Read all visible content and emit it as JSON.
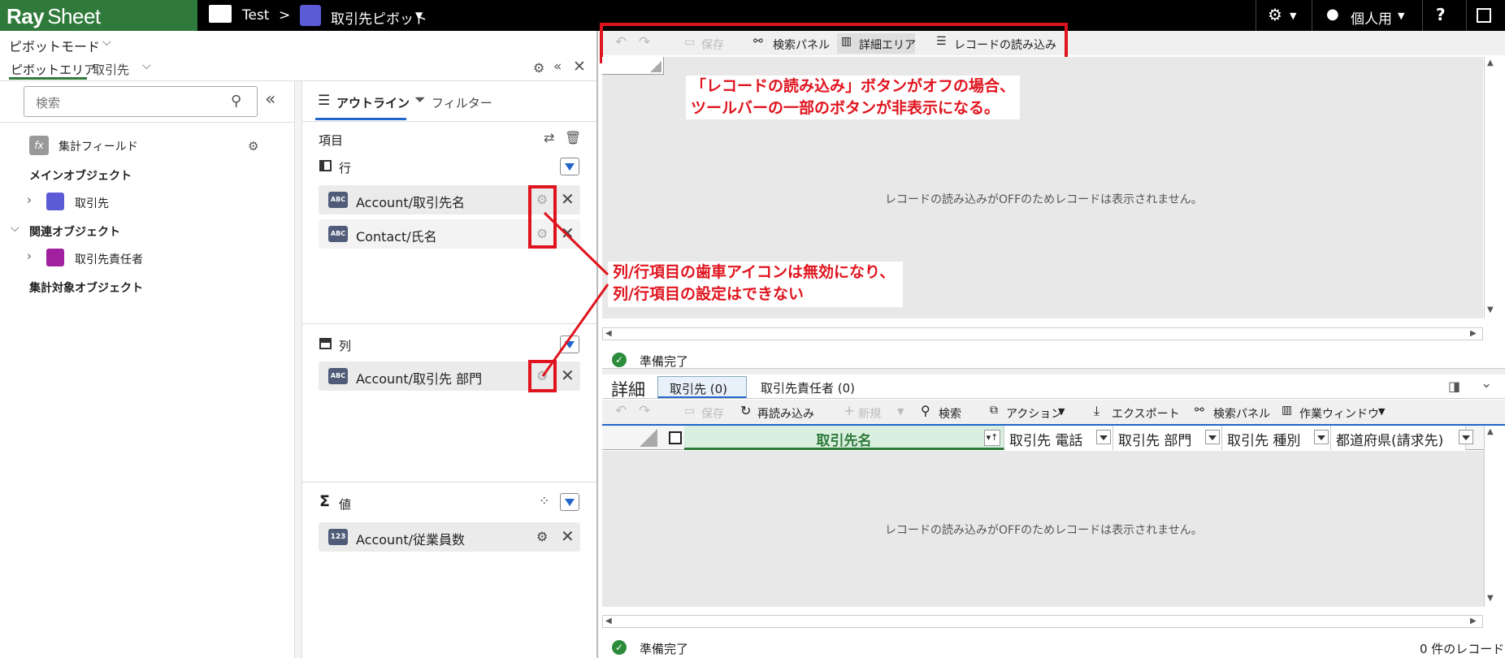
{
  "topbar": {
    "logo_bold": "Ray",
    "logo_light": "Sheet",
    "breadcrumb_folder": "Test",
    "breadcrumb_sep": ">",
    "sheet_name": "取引先ピボット",
    "user_label": "個人用",
    "help_label": "?"
  },
  "left": {
    "mode_label": "ピボットモード",
    "tab_pivot": "ピボットエリア",
    "tab_object": "取引先",
    "search_placeholder": "検索",
    "calc_field": "集計フィールド",
    "main_object_heading": "メインオブジェクト",
    "main_object": "取引先",
    "related_heading": "関連オブジェクト",
    "related_object": "取引先責任者",
    "target_heading": "集計対象オブジェクト"
  },
  "middle": {
    "tab_outline": "アウトライン",
    "tab_filter": "フィルター",
    "items_label": "項目",
    "rows_label": "行",
    "rows": [
      "Account/取引先名",
      "Contact/氏名"
    ],
    "cols_label": "列",
    "cols": [
      "Account/取引先 部門"
    ],
    "values_label": "値",
    "values": [
      "Account/従業員数"
    ],
    "abc_badge": "ABC",
    "num_badge": "123"
  },
  "pivot_toolbar": {
    "save": "保存",
    "search_panel": "検索パネル",
    "detail_area": "詳細エリア",
    "load_records": "レコードの読み込み"
  },
  "pivot": {
    "empty_message": "レコードの読み込みがOFFのためレコードは表示されません。",
    "status": "準備完了"
  },
  "annotations": {
    "top_line1": "「レコードの読み込み」ボタンがオフの場合、",
    "top_line2": "ツールバーの一部のボタンが非表示になる。",
    "mid_line1": "列/行項目の歯車アイコンは無効になり、",
    "mid_line2": "列/行項目の設定はできない"
  },
  "detail": {
    "title": "詳細",
    "tab1": "取引先 (0)",
    "tab2": "取引先責任者 (0)",
    "toolbar": {
      "save": "保存",
      "reload": "再読み込み",
      "new": "新規",
      "search": "検索",
      "action": "アクション",
      "export": "エクスポート",
      "search_panel": "検索パネル",
      "work_window": "作業ウィンドウ"
    },
    "columns": [
      "取引先名",
      "取引先 電話",
      "取引先 部門",
      "取引先 種別",
      "都道府県(請求先)"
    ],
    "empty_message": "レコードの読み込みがOFFのためレコードは表示されません。",
    "status": "準備完了",
    "record_count": "0 件のレコード"
  },
  "colors": {
    "accent_green": "#2f7a3a",
    "annotation_red": "#e0141e",
    "header_green": "#d9efe0"
  }
}
